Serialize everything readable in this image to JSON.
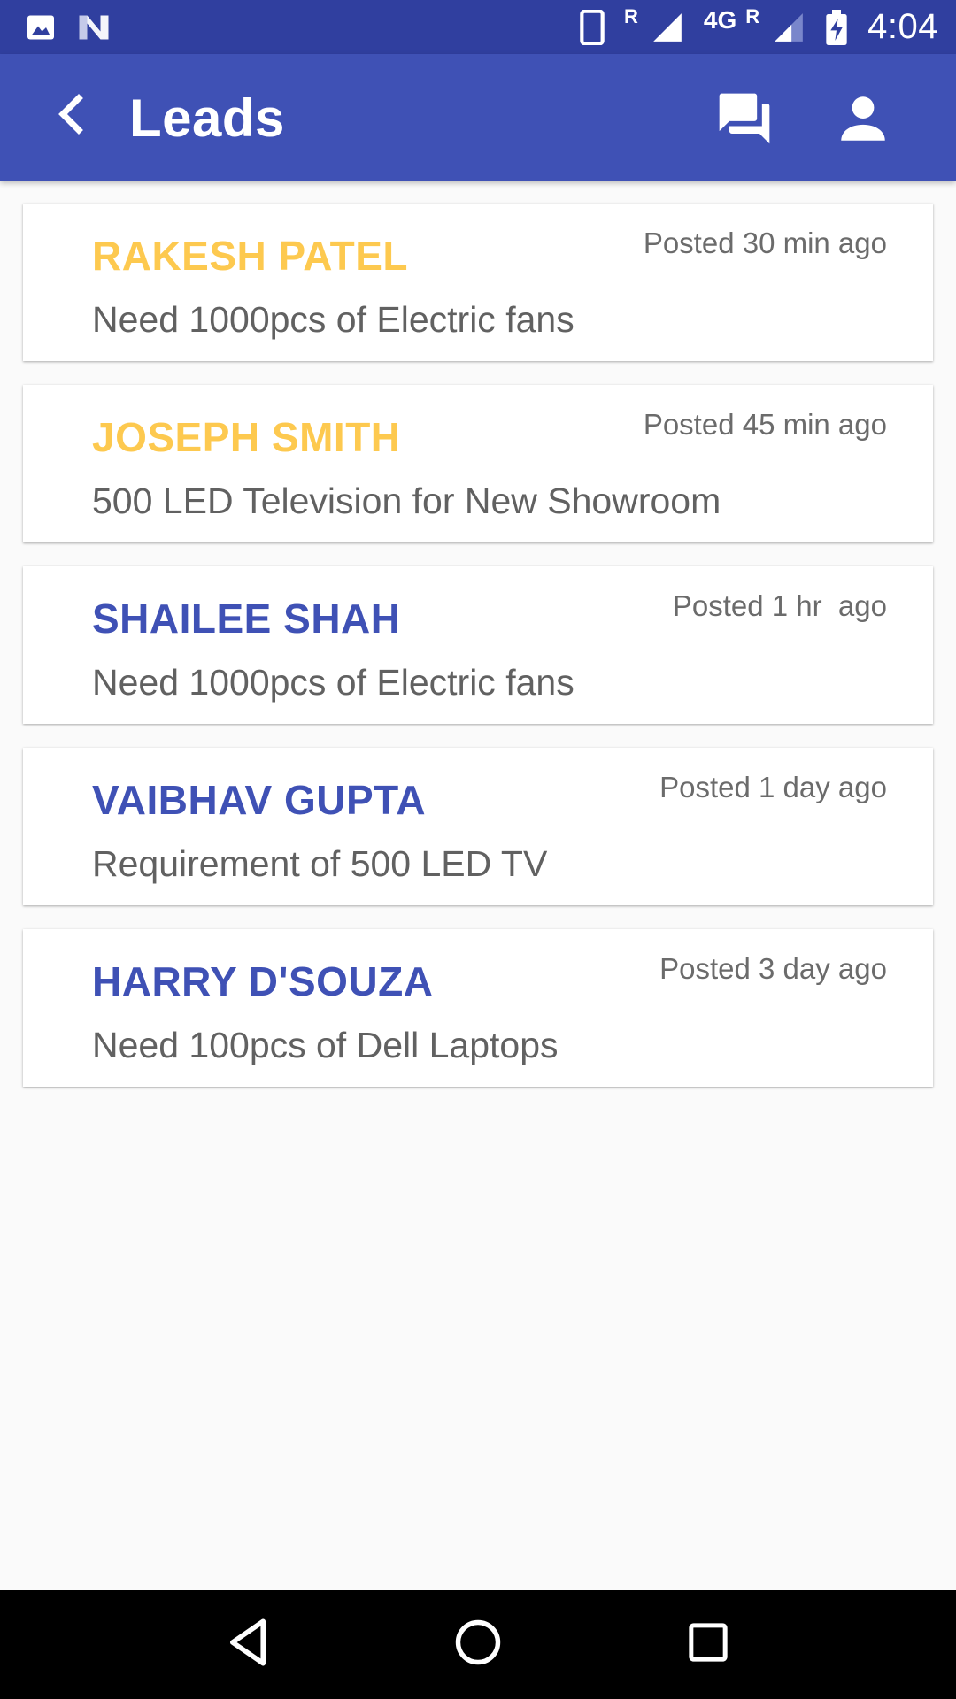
{
  "status_bar": {
    "time": "4:04",
    "network": "4G",
    "roaming_1": "R",
    "roaming_2": "R",
    "icons": [
      "image-icon",
      "n-notification-icon",
      "phone-vibrate-icon",
      "signal-icon",
      "battery-charging-icon"
    ]
  },
  "app_bar": {
    "title": "Leads",
    "color": "#3f51b5",
    "status_color": "#303f9f"
  },
  "leads": [
    {
      "name": "RAKESH PATEL",
      "posted": "Posted 30 min ago",
      "description": "Need 1000pcs of Electric fans",
      "highlighted": true
    },
    {
      "name": "JOSEPH SMITH",
      "posted": "Posted 45 min ago",
      "description": "500 LED Television for New Showroom",
      "highlighted": true
    },
    {
      "name": "SHAILEE SHAH",
      "posted": "Posted 1 hr  ago",
      "description": "Need 1000pcs of Electric fans",
      "highlighted": false
    },
    {
      "name": "VAIBHAV GUPTA",
      "posted": "Posted 1 day ago",
      "description": "Requirement of 500 LED TV",
      "highlighted": false
    },
    {
      "name": "HARRY D'SOUZA",
      "posted": "Posted 3 day ago",
      "description": "Need 100pcs of Dell Laptops",
      "highlighted": false
    }
  ],
  "colors": {
    "highlight_name": "#fdc94f",
    "normal_name": "#3f51b5"
  }
}
